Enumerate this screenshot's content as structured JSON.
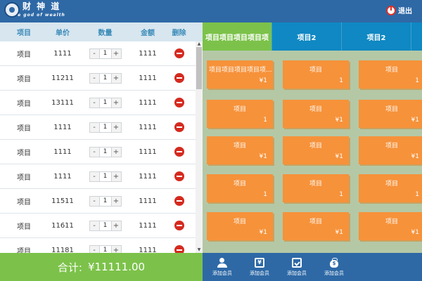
{
  "header": {
    "logo_cn": "财 神 道",
    "logo_en": "the god of wealth",
    "logout_label": "退出"
  },
  "order_table": {
    "headers": [
      "项目",
      "单价",
      "数量",
      "金额",
      "删除"
    ],
    "rows": [
      {
        "name": "项目",
        "price": "1111",
        "qty": "1",
        "amount": "1111"
      },
      {
        "name": "项目",
        "price": "11211",
        "qty": "1",
        "amount": "1111"
      },
      {
        "name": "项目",
        "price": "13111",
        "qty": "1",
        "amount": "1111"
      },
      {
        "name": "项目",
        "price": "1111",
        "qty": "1",
        "amount": "1111"
      },
      {
        "name": "项目",
        "price": "1111",
        "qty": "1",
        "amount": "1111"
      },
      {
        "name": "项目",
        "price": "1111",
        "qty": "1",
        "amount": "1111"
      },
      {
        "name": "项目",
        "price": "11511",
        "qty": "1",
        "amount": "1111"
      },
      {
        "name": "项目",
        "price": "11611",
        "qty": "1",
        "amount": "1111"
      },
      {
        "name": "项目",
        "price": "11181",
        "qty": "1",
        "amount": "1111"
      }
    ],
    "minus_label": "-",
    "plus_label": "+"
  },
  "total": {
    "label": "合计:",
    "value": "¥11111.00"
  },
  "tabs": [
    {
      "label": "项目项目项目项目项",
      "active": true
    },
    {
      "label": "项目2",
      "active": false
    },
    {
      "label": "项目2",
      "active": false
    },
    {
      "label": "",
      "active": false
    }
  ],
  "products": [
    [
      {
        "name": "项目项目项目项目项...",
        "price": "¥1"
      },
      {
        "name": "项目",
        "price": "1"
      },
      {
        "name": "项目",
        "price": "1"
      }
    ],
    [
      {
        "name": "项目",
        "price": "1"
      },
      {
        "name": "项目",
        "price": "¥1"
      },
      {
        "name": "项目",
        "price": "¥1"
      }
    ],
    [
      {
        "name": "项目",
        "price": "¥1"
      },
      {
        "name": "项目",
        "price": "¥1"
      },
      {
        "name": "项目",
        "price": "¥1"
      }
    ],
    [
      {
        "name": "项目",
        "price": "1"
      },
      {
        "name": "项目",
        "price": "1"
      },
      {
        "name": "项目",
        "price": "1"
      }
    ],
    [
      {
        "name": "项目",
        "price": "¥1"
      },
      {
        "name": "项目",
        "price": "¥1"
      },
      {
        "name": "项目",
        "price": "¥1"
      }
    ]
  ],
  "actions": [
    {
      "label": "添加会员",
      "icon": "users-icon"
    },
    {
      "label": "添加会员",
      "icon": "yen-receipt-icon"
    },
    {
      "label": "添加会员",
      "icon": "clipboard-check-icon"
    },
    {
      "label": "添加会员",
      "icon": "money-bag-icon"
    }
  ]
}
